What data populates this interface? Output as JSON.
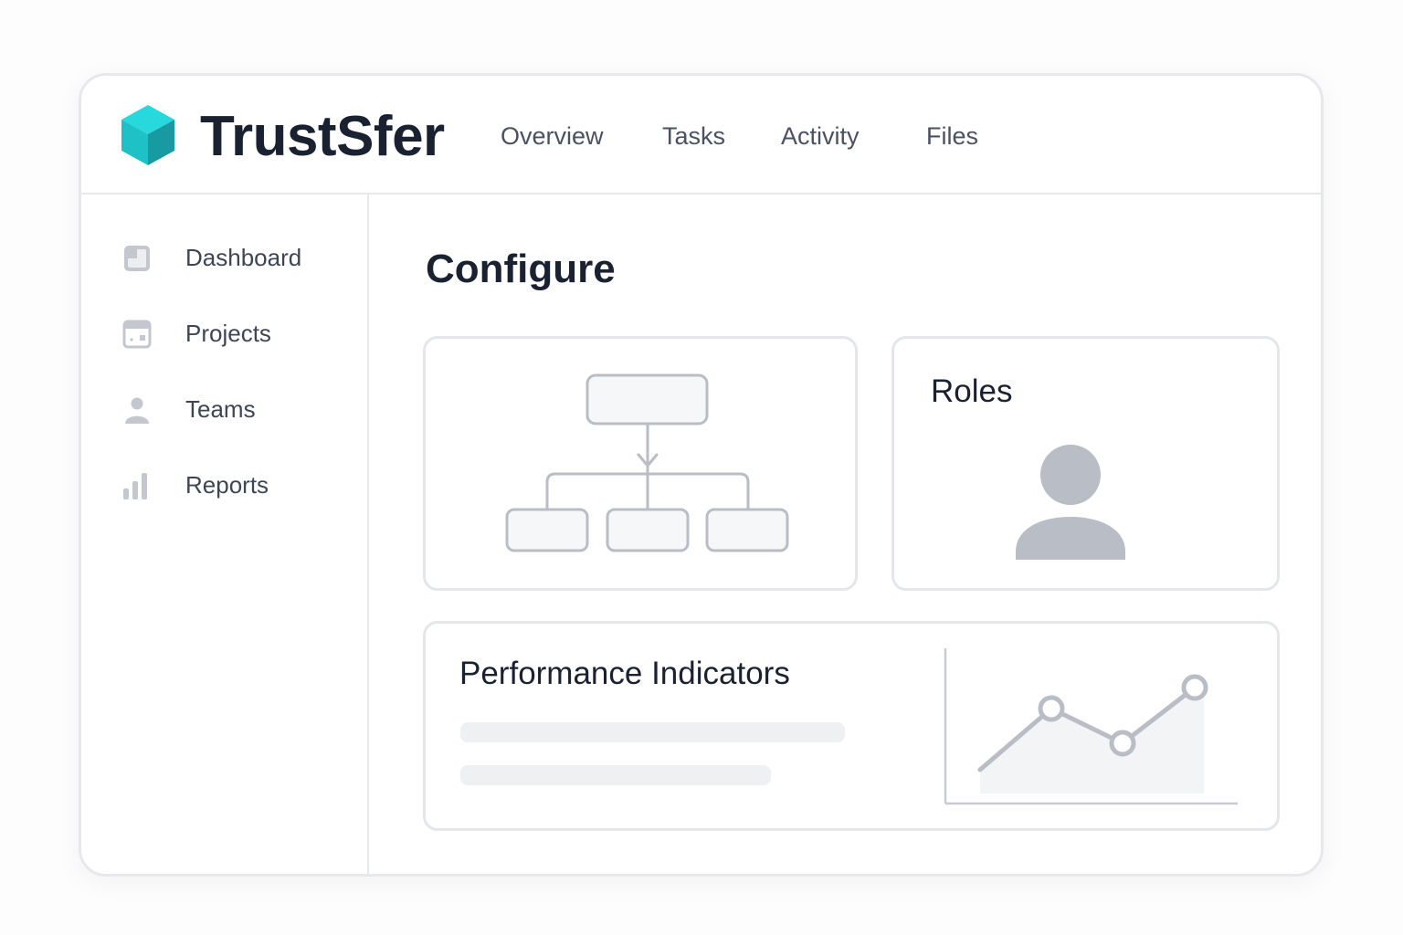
{
  "app": {
    "name": "TrustSfer",
    "accent_color": "#1cc7cd"
  },
  "header": {
    "logo_icon": "cube-icon",
    "nav": [
      {
        "label": "Overview"
      },
      {
        "label": "Tasks"
      },
      {
        "label": "Activity"
      },
      {
        "label": "Files"
      }
    ]
  },
  "sidebar": {
    "items": [
      {
        "label": "Dashboard",
        "icon": "dashboard-icon"
      },
      {
        "label": "Projects",
        "icon": "calendar-icon"
      },
      {
        "label": "Teams",
        "icon": "user-icon"
      },
      {
        "label": "Reports",
        "icon": "bar-chart-icon"
      }
    ]
  },
  "main": {
    "title": "Configure",
    "cards": {
      "hierarchy": {
        "icon": "org-chart-icon"
      },
      "roles": {
        "title": "Roles",
        "icon": "user-avatar-icon"
      },
      "performance": {
        "title": "Performance Indicators",
        "icon": "line-chart-icon"
      }
    }
  }
}
